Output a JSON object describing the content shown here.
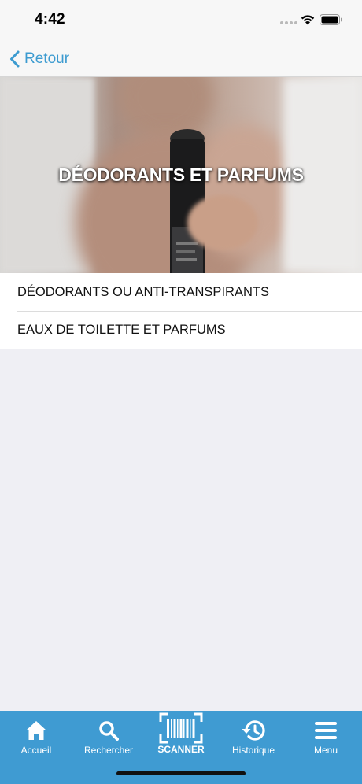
{
  "status_bar": {
    "time": "4:42"
  },
  "nav": {
    "back_label": "Retour"
  },
  "hero": {
    "title": "DÉODORANTS ET PARFUMS"
  },
  "categories": [
    {
      "label": "DÉODORANTS OU ANTI-TRANSPIRANTS"
    },
    {
      "label": "EAUX DE TOILETTE ET PARFUMS"
    }
  ],
  "tab_bar": {
    "tabs": [
      {
        "label": "Accueil",
        "icon": "home-icon"
      },
      {
        "label": "Rechercher",
        "icon": "search-icon"
      },
      {
        "label": "SCANNER",
        "icon": "barcode-icon"
      },
      {
        "label": "Historique",
        "icon": "history-icon"
      },
      {
        "label": "Menu",
        "icon": "menu-icon"
      }
    ]
  },
  "colors": {
    "accent": "#3c9bd0",
    "tab_bar": "#3f9bd2",
    "background": "#efeff4"
  }
}
